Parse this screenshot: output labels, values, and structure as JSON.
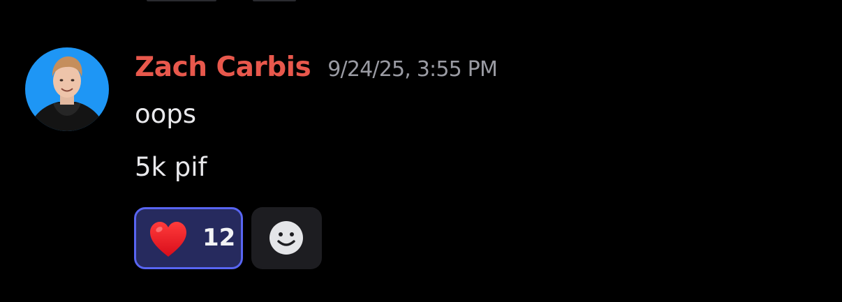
{
  "message": {
    "author": {
      "name": "Zach Carbis",
      "name_color": "#e8584c",
      "avatar_background": "#1e96f5"
    },
    "timestamp": "9/24/25, 3:55 PM",
    "lines": [
      "oops",
      "5k pif"
    ]
  },
  "reactions": [
    {
      "emoji": "heart-icon",
      "count": "12",
      "selected": true,
      "accent_color": "#5865f2"
    }
  ],
  "add_reaction": {
    "icon": "smiley-face-icon"
  }
}
